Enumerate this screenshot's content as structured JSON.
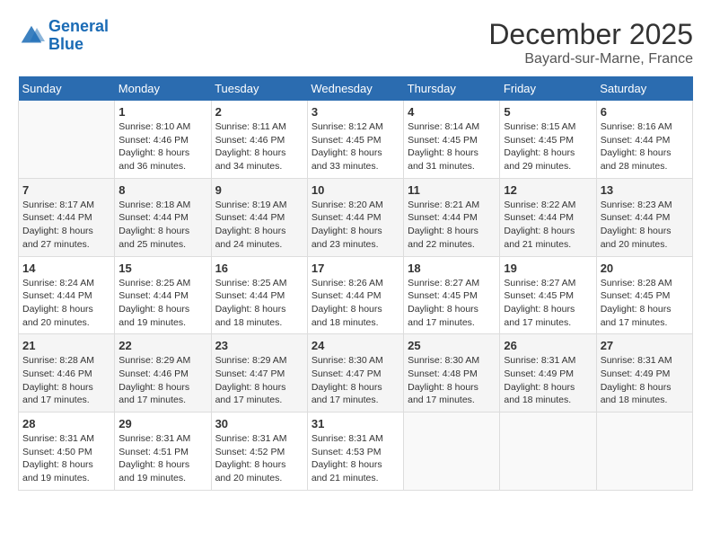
{
  "logo": {
    "line1": "General",
    "line2": "Blue"
  },
  "title": "December 2025",
  "subtitle": "Bayard-sur-Marne, France",
  "days_of_week": [
    "Sunday",
    "Monday",
    "Tuesday",
    "Wednesday",
    "Thursday",
    "Friday",
    "Saturday"
  ],
  "weeks": [
    [
      {
        "day": "",
        "info": ""
      },
      {
        "day": "1",
        "info": "Sunrise: 8:10 AM\nSunset: 4:46 PM\nDaylight: 8 hours\nand 36 minutes."
      },
      {
        "day": "2",
        "info": "Sunrise: 8:11 AM\nSunset: 4:46 PM\nDaylight: 8 hours\nand 34 minutes."
      },
      {
        "day": "3",
        "info": "Sunrise: 8:12 AM\nSunset: 4:45 PM\nDaylight: 8 hours\nand 33 minutes."
      },
      {
        "day": "4",
        "info": "Sunrise: 8:14 AM\nSunset: 4:45 PM\nDaylight: 8 hours\nand 31 minutes."
      },
      {
        "day": "5",
        "info": "Sunrise: 8:15 AM\nSunset: 4:45 PM\nDaylight: 8 hours\nand 29 minutes."
      },
      {
        "day": "6",
        "info": "Sunrise: 8:16 AM\nSunset: 4:44 PM\nDaylight: 8 hours\nand 28 minutes."
      }
    ],
    [
      {
        "day": "7",
        "info": "Sunrise: 8:17 AM\nSunset: 4:44 PM\nDaylight: 8 hours\nand 27 minutes."
      },
      {
        "day": "8",
        "info": "Sunrise: 8:18 AM\nSunset: 4:44 PM\nDaylight: 8 hours\nand 25 minutes."
      },
      {
        "day": "9",
        "info": "Sunrise: 8:19 AM\nSunset: 4:44 PM\nDaylight: 8 hours\nand 24 minutes."
      },
      {
        "day": "10",
        "info": "Sunrise: 8:20 AM\nSunset: 4:44 PM\nDaylight: 8 hours\nand 23 minutes."
      },
      {
        "day": "11",
        "info": "Sunrise: 8:21 AM\nSunset: 4:44 PM\nDaylight: 8 hours\nand 22 minutes."
      },
      {
        "day": "12",
        "info": "Sunrise: 8:22 AM\nSunset: 4:44 PM\nDaylight: 8 hours\nand 21 minutes."
      },
      {
        "day": "13",
        "info": "Sunrise: 8:23 AM\nSunset: 4:44 PM\nDaylight: 8 hours\nand 20 minutes."
      }
    ],
    [
      {
        "day": "14",
        "info": "Sunrise: 8:24 AM\nSunset: 4:44 PM\nDaylight: 8 hours\nand 20 minutes."
      },
      {
        "day": "15",
        "info": "Sunrise: 8:25 AM\nSunset: 4:44 PM\nDaylight: 8 hours\nand 19 minutes."
      },
      {
        "day": "16",
        "info": "Sunrise: 8:25 AM\nSunset: 4:44 PM\nDaylight: 8 hours\nand 18 minutes."
      },
      {
        "day": "17",
        "info": "Sunrise: 8:26 AM\nSunset: 4:44 PM\nDaylight: 8 hours\nand 18 minutes."
      },
      {
        "day": "18",
        "info": "Sunrise: 8:27 AM\nSunset: 4:45 PM\nDaylight: 8 hours\nand 17 minutes."
      },
      {
        "day": "19",
        "info": "Sunrise: 8:27 AM\nSunset: 4:45 PM\nDaylight: 8 hours\nand 17 minutes."
      },
      {
        "day": "20",
        "info": "Sunrise: 8:28 AM\nSunset: 4:45 PM\nDaylight: 8 hours\nand 17 minutes."
      }
    ],
    [
      {
        "day": "21",
        "info": "Sunrise: 8:28 AM\nSunset: 4:46 PM\nDaylight: 8 hours\nand 17 minutes."
      },
      {
        "day": "22",
        "info": "Sunrise: 8:29 AM\nSunset: 4:46 PM\nDaylight: 8 hours\nand 17 minutes."
      },
      {
        "day": "23",
        "info": "Sunrise: 8:29 AM\nSunset: 4:47 PM\nDaylight: 8 hours\nand 17 minutes."
      },
      {
        "day": "24",
        "info": "Sunrise: 8:30 AM\nSunset: 4:47 PM\nDaylight: 8 hours\nand 17 minutes."
      },
      {
        "day": "25",
        "info": "Sunrise: 8:30 AM\nSunset: 4:48 PM\nDaylight: 8 hours\nand 17 minutes."
      },
      {
        "day": "26",
        "info": "Sunrise: 8:31 AM\nSunset: 4:49 PM\nDaylight: 8 hours\nand 18 minutes."
      },
      {
        "day": "27",
        "info": "Sunrise: 8:31 AM\nSunset: 4:49 PM\nDaylight: 8 hours\nand 18 minutes."
      }
    ],
    [
      {
        "day": "28",
        "info": "Sunrise: 8:31 AM\nSunset: 4:50 PM\nDaylight: 8 hours\nand 19 minutes."
      },
      {
        "day": "29",
        "info": "Sunrise: 8:31 AM\nSunset: 4:51 PM\nDaylight: 8 hours\nand 19 minutes."
      },
      {
        "day": "30",
        "info": "Sunrise: 8:31 AM\nSunset: 4:52 PM\nDaylight: 8 hours\nand 20 minutes."
      },
      {
        "day": "31",
        "info": "Sunrise: 8:31 AM\nSunset: 4:53 PM\nDaylight: 8 hours\nand 21 minutes."
      },
      {
        "day": "",
        "info": ""
      },
      {
        "day": "",
        "info": ""
      },
      {
        "day": "",
        "info": ""
      }
    ]
  ]
}
